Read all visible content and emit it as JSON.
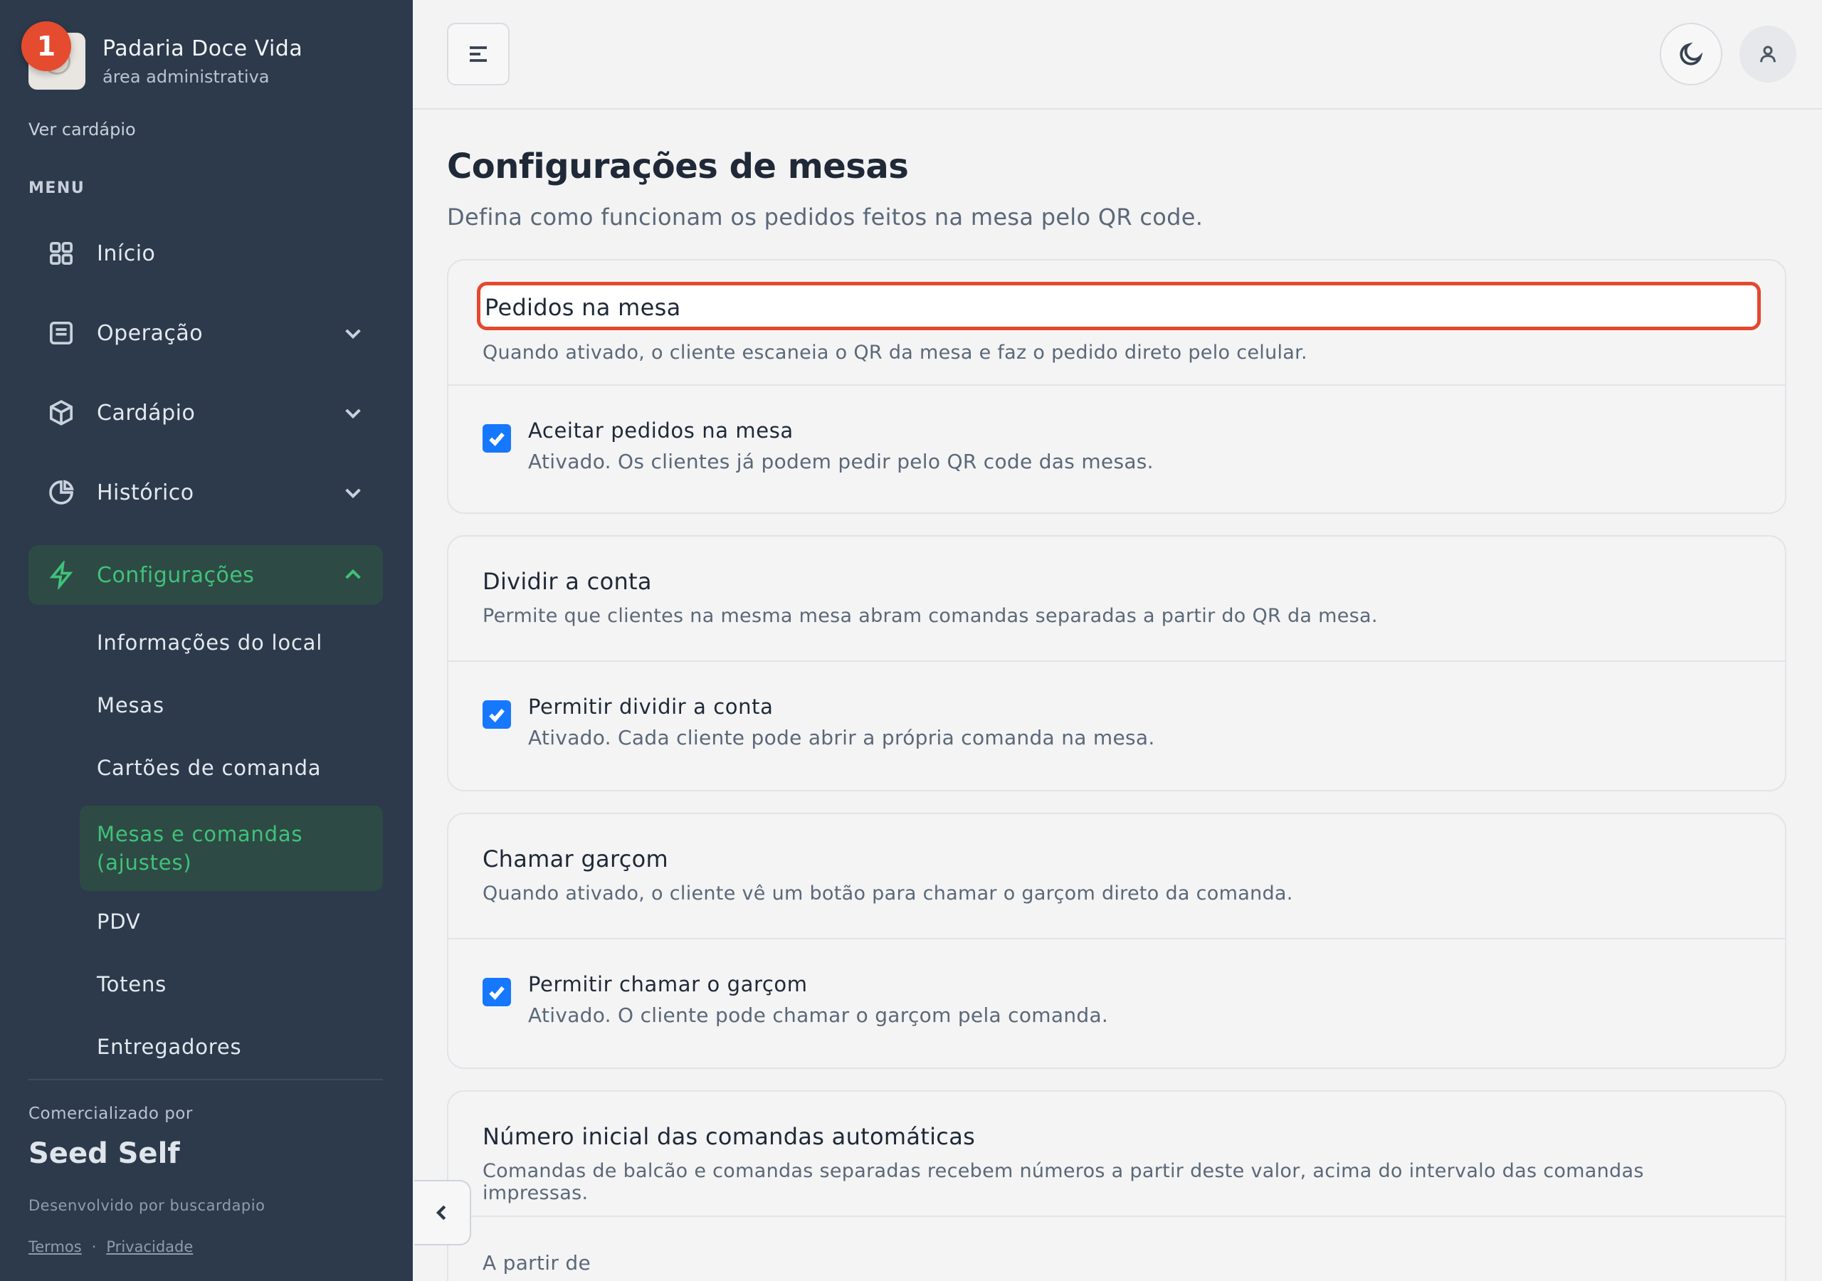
{
  "brand": {
    "name": "Padaria Doce Vida",
    "subtitle": "área administrativa",
    "notification_count": "1"
  },
  "sidebar": {
    "view_menu": "Ver cardápio",
    "menu_label": "MENU",
    "items": [
      {
        "label": "Início",
        "icon": "grid-icon"
      },
      {
        "label": "Operação",
        "icon": "list-icon"
      },
      {
        "label": "Cardápio",
        "icon": "box-icon"
      },
      {
        "label": "Histórico",
        "icon": "pie-chart-icon"
      },
      {
        "label": "Configurações",
        "icon": "bolt-icon"
      }
    ],
    "sub_items": [
      {
        "label": "Informações do local"
      },
      {
        "label": "Mesas"
      },
      {
        "label": "Cartões de comanda"
      },
      {
        "label": "Mesas e comandas (ajustes)"
      },
      {
        "label": "PDV"
      },
      {
        "label": "Totens"
      },
      {
        "label": "Entregadores"
      }
    ],
    "commercialized_by": "Comercializado por",
    "company": "Seed Self",
    "developed_by": "Desenvolvido por buscardapio",
    "terms": "Termos",
    "separator": "·",
    "privacy": "Privacidade"
  },
  "page": {
    "title": "Configurações de mesas",
    "subtitle": "Defina como funcionam os pedidos feitos na mesa pelo QR code."
  },
  "cards": [
    {
      "title": "Pedidos na mesa",
      "description": "Quando ativado, o cliente escaneia o QR da mesa e faz o pedido direto pelo celular.",
      "option_title": "Aceitar pedidos na mesa",
      "option_desc": "Ativado. Os clientes já podem pedir pelo QR code das mesas."
    },
    {
      "title": "Dividir a conta",
      "description": "Permite que clientes na mesma mesa abram comandas separadas a partir do QR da mesa.",
      "option_title": "Permitir dividir a conta",
      "option_desc": "Ativado. Cada cliente pode abrir a própria comanda na mesa."
    },
    {
      "title": "Chamar garçom",
      "description": "Quando ativado, o cliente vê um botão para chamar o garçom direto da comanda.",
      "option_title": "Permitir chamar o garçom",
      "option_desc": "Ativado. O cliente pode chamar o garçom pela comanda."
    },
    {
      "title": "Número inicial das comandas automáticas",
      "description": "Comandas de balcão e comandas separadas recebem números a partir deste valor, acima do intervalo das comandas impressas.",
      "field_label": "A partir de"
    }
  ],
  "colors": {
    "sidebar_bg": "#2c3a4b",
    "accent": "#3fc27a",
    "checkbox": "#1677ff",
    "highlight": "#e5482d"
  }
}
